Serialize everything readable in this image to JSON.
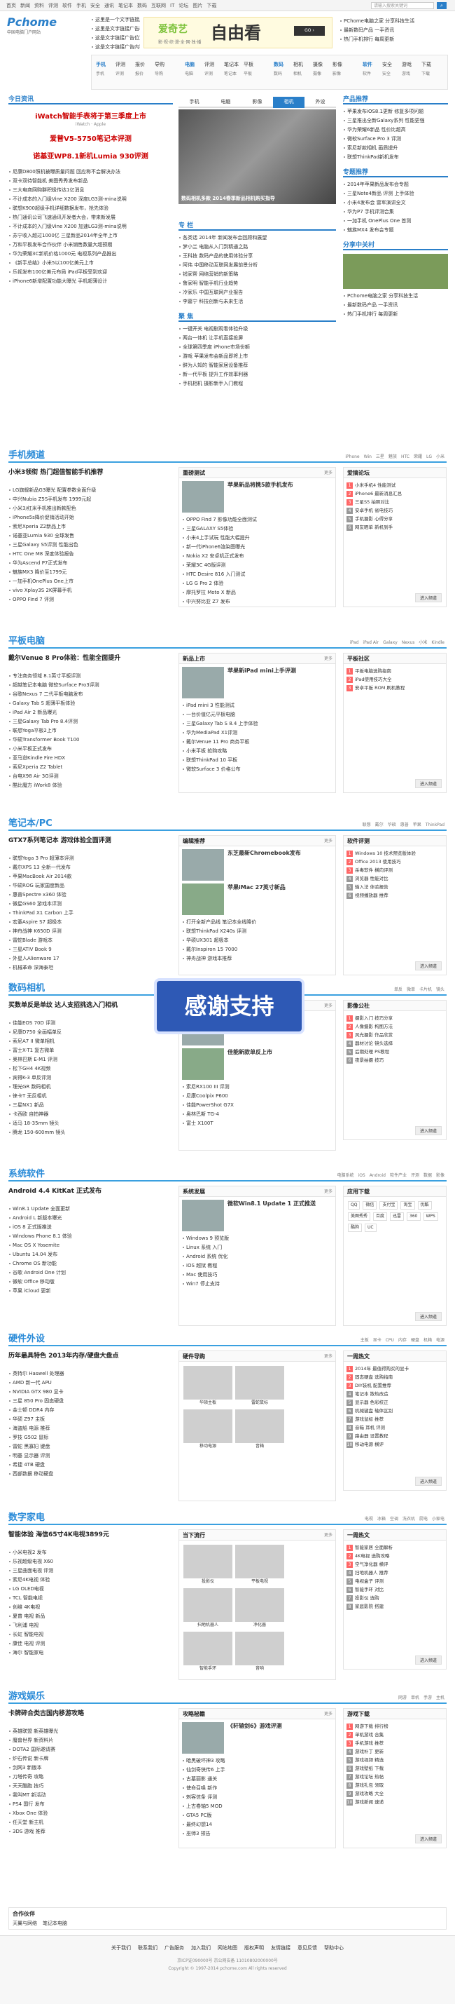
{
  "topbar": {
    "links": [
      "首页",
      "新闻",
      "资料",
      "评测",
      "软件",
      "手机",
      "安全",
      "通讯",
      "笔记本",
      "数码",
      "互联网",
      "IT",
      "论坛",
      "图片",
      "下载"
    ],
    "login": "请输入搜索关键词"
  },
  "logo": {
    "text": "Pchome",
    "sub": "中国电脑门户网站"
  },
  "top_left_links": [
    "这里是一个文字链接广告",
    "这里是文字链接广告标题",
    "这是文字链接广告位置",
    "这是文字链接广告内容"
  ],
  "banner": {
    "brand": "爱奇艺",
    "big": "自由看",
    "slogan": "影·视·综·漫·全·网·独·播"
  },
  "nav_groups": [
    [
      "手机",
      "评测",
      "报价",
      "导购"
    ],
    [
      "电脑",
      "评测",
      "笔记本",
      "平板"
    ],
    [
      "数码",
      "相机",
      "摄像",
      "影像"
    ],
    [
      "软件",
      "安全",
      "游戏",
      "下载"
    ]
  ],
  "today": {
    "title": "今日资讯",
    "headline1": "iWatch智能手表将于第三季度上市",
    "headline2": "爱普V5-5750笔记本评测",
    "headline3": "诺基亚WP8.1新机Lumia 930评测",
    "list": [
      "尼康D800照机被曝质量问题 回应称不会解决办法",
      "双卡双待智能机 美图秀秀发布新品",
      "三大电商网购群积极传达1亿消息",
      "不计成本的入门级Vine X200 深度LG3测-mina说明",
      "联想K900超级手机详细数据发布，抢先体验",
      "热门通讯公司飞速通讯开发者大会，带来新发展",
      "不计成本的入门级Vine X200 加速LG3测-mina说明",
      "苏宁收入超过1000亿 三星新品2014年全年上市",
      "万和平板发布合作伙伴 小米销售数量大超预期",
      "华为荣耀3C新机价格1000元 电视系列产品推出",
      "《新手总结》小米5以100亿美元上市",
      "乐视发布100亿美元布局 iPad平板受到欢迎",
      "iPhone6新增配置功能大曝光 手机超薄设计"
    ]
  },
  "slides": {
    "tabs": [
      "手机",
      "电脑",
      "影像",
      "相机",
      "外设"
    ],
    "caption": "数码相机多款 2014春季新品相机购买指导"
  },
  "topic": {
    "title": "专 栏",
    "items": [
      "各类话 2014年 新闻发布会回顾和展望",
      "梦小兰 电脑从入门到精通之路",
      "王科技 数码产品的使用体验分享",
      "阿伟 中国移动互联网发展前景分析",
      "钱家帮 网络营销的新策略",
      "鲁家明 智能手机行业趋势",
      "冷家乐 中国互联网产业报告",
      "李嘉宁 科技创新与未来生活"
    ]
  },
  "focus": {
    "title": "聚 焦",
    "items": [
      "一键开关 电视剧观看体验升级",
      "两台一体机 让手机直接投屏",
      "全球第四季度 iPhone市场份额",
      "游戏 苹果发布会新品即将上市",
      "鲜为人知的 智能家居设备推荐",
      "新一代平板 提升工作效率利器",
      "手机相机 摄影新手入门教程"
    ]
  },
  "right1": {
    "title": "产品推荐",
    "items": [
      "苹果发布iOS8.1更新 修复多项问题",
      "三星推出全新Galaxy系列 性能更强",
      "华为荣耀6新品 性价比超高",
      "微软Surface Pro 3 评测",
      "索尼新款相机 画质提升",
      "联想ThinkPad新机发布"
    ]
  },
  "right2": {
    "title": "专题推荐",
    "items": [
      "2014年苹果新品发布会专题",
      "三星Note4新品 评测 上手体验",
      "小米4发布会 雷军演讲全文",
      "华为P7 手机评测合集",
      "一加手机 OnePlus One 首测",
      "魅族MX4 发布会专题"
    ]
  },
  "right3": {
    "title": "分享中关村",
    "items": [
      "PChome电脑之家 分享科技生活",
      "最新数码产品 一手资讯",
      "热门手机排行 每周更新"
    ]
  },
  "sec_phone": {
    "title": "手机频道",
    "nav": [
      "iPhone",
      "Win",
      "三星",
      "魅族",
      "HTC",
      "荣耀",
      "LG",
      "小米"
    ],
    "head": "小米3领衔 热门超值智能手机推荐",
    "list": [
      "LG旗舰新品G3曝光 配置参数全面升级",
      "中兴Nubia Z5S手机发布 1999元起",
      "小米3/红米手机推出新款配色",
      "iPhone5s降价促销活动开始",
      "索尼Xperia Z2新品上市",
      "诺基亚Lumia 930 全球发售",
      "三星Galaxy S5评测 性能出色",
      "HTC One M8 深度体验报告",
      "华为Ascend P7正式发布",
      "魅族MX3 降价至1799元",
      "一加手机OnePlus One上市",
      "vivo Xplay3S 2K屏幕手机",
      "OPPO Find 7 评测"
    ],
    "mid_title": "重磅测试",
    "mid_head": "苹果新品将携5款手机发布",
    "mid_list": [
      "OPPO Find 7 影像功能全面测试",
      "三星GALAXY S5体验",
      "小米4上手试玩 性能大幅提升",
      "新一代iPhone6渲染图曝光",
      "Nokia X2 安卓机正式发布",
      "荣耀3C 4G版评测",
      "HTC Desire 816 入门测试",
      "LG G Pro 2 体验",
      "摩托罗拉 Moto X 新品",
      "中兴努比亚 Z7 发布"
    ],
    "right_title": "爱搞论坛",
    "right_list": [
      "小米手机4 性能测试",
      "iPhone6 最新消息汇总",
      "三星S5 拍照对比",
      "安卓手机 省电技巧",
      "手机摄影 心得分享",
      "网友晒单 新机到手"
    ]
  },
  "sec_tablet": {
    "title": "平板电脑",
    "nav": [
      "iPad",
      "iPad Air",
      "Galaxy",
      "Nexus",
      "小米",
      "Kindle"
    ],
    "head": "戴尔Venue 8 Pro体验：性能全面提升",
    "list": [
      "专注商务领域 8.1英寸平板评测",
      "超越笔记本电脑 微软Surface Pro3评测",
      "谷歌Nexus 7 二代平板电脑发布",
      "Galaxy Tab S 超薄平板体验",
      "iPad Air 2 新品曝光",
      "三星Galaxy Tab Pro 8.4评测",
      "联想Yoga平板2上市",
      "华硕Transformer Book T100",
      "小米平板正式发布",
      "亚马逊Kindle Fire HDX",
      "索尼Xperia Z2 Tablet",
      "台电X98 Air 3G评测",
      "酷比魔方 iWork8 体验"
    ],
    "mid_title": "新品上市",
    "mid_head": "苹果新iPad mini上手评测",
    "mid_list": [
      "iPad mini 3 性能测试",
      "一台价值亿元平板电脑",
      "三星Galaxy Tab S 8.4 上手体验",
      "华为MediaPad X1评测",
      "戴尔Venue 11 Pro 商务平板",
      "小米平板 抢购攻略",
      "联想ThinkPad 10 平板",
      "微软Surface 3 价格公布"
    ],
    "right_title": "平板社区",
    "right_list": [
      "平板电脑选购指南",
      "iPad使用技巧大全",
      "安卓平板 ROM 刷机教程"
    ]
  },
  "sec_note": {
    "title": "笔记本/PC",
    "nav": [
      "联想",
      "戴尔",
      "华硕",
      "惠普",
      "苹果",
      "ThinkPad"
    ],
    "head": "GTX7系列笔记本 游戏体验全面评测",
    "list": [
      "联想Yoga 3 Pro 超薄本评测",
      "戴尔XPS 13 全新一代发布",
      "苹果MacBook Air 2014款",
      "华硕ROG 玩家国度新品",
      "惠普Spectre x360 体验",
      "微星GS60 游戏本评测",
      "ThinkPad X1 Carbon 上手",
      "宏碁Aspire S7 超极本",
      "神舟战神 K650D 评测",
      "雷蛇Blade 游戏本",
      "三星ATIV Book 9",
      "外星人Alienware 17",
      "机械革命 深海泰坦"
    ],
    "mid_title": "编辑推荐",
    "mid_head1": "东芝最新Chromebook发布",
    "mid_head2": "苹果iMac 27英寸新品",
    "mid_list": [
      "打开全新产品线 笔记本全线降价",
      "联想ThinkPad X240s 评测",
      "华硕UX301 超极本",
      "戴尔Inspiron 15 7000",
      "神舟战神 游戏本推荐"
    ],
    "right_title": "软件评测",
    "right_list": [
      "Windows 10 技术预览版体验",
      "Office 2013 使用技巧",
      "杀毒软件 横向评测",
      "浏览器 性能对比",
      "输入法 体验报告",
      "视频播放器 推荐"
    ]
  },
  "sec_camera": {
    "title": "数码相机",
    "nav": [
      "单反",
      "微单",
      "卡片机",
      "镜头"
    ],
    "head": "买数单反是单纹 达人支招挑选入门相机",
    "list": [
      "佳能EOS 70D 评测",
      "尼康D750 全画幅单反",
      "索尼A7 II 微单相机",
      "富士X-T1 复古微单",
      "奥林巴斯 E-M1 评测",
      "松下GH4 4K视频",
      "宾得K-3 单反评测",
      "理光GR 数码相机",
      "徕卡T 无反相机",
      "三星NX1 新品",
      "卡西欧 自拍神器",
      "适马 18-35mm 镜头",
      "腾龙 150-600mm 镜头"
    ],
    "mid_title": "数码相机",
    "mid_head1": "卡西欧新品 女神自拍神器",
    "mid_head2": "佳能新款单反上市",
    "mid_list": [
      "索尼RX100 III 评测",
      "尼康Coolpix P600",
      "佳能PowerShot G7X",
      "奥林巴斯 TG-4",
      "富士 X100T"
    ],
    "right_title": "影像公社",
    "right_list": [
      "摄影入门 技巧分享",
      "人像摄影 构图方法",
      "风光摄影 作品欣赏",
      "器材讨论 镜头选择",
      "后期处理 PS教程",
      "夜景拍摄 技巧"
    ]
  },
  "thanks": "感谢支持",
  "sec_soft": {
    "title": "系统软件",
    "nav": [
      "电脑系统",
      "iOS",
      "Android",
      "软件产业",
      "评测",
      "数据",
      "影像"
    ],
    "head": "Android 4.4 KitKat 正式发布",
    "list": [
      "Win8.1 Update 全面更新",
      "Android L 新版本曝光",
      "iOS 8 正式版推送",
      "Windows Phone 8.1 体验",
      "Mac OS X Yosemite",
      "Ubuntu 14.04 发布",
      "Chrome OS 新功能",
      "谷歌 Android One 计划",
      "微软 Office 移动版",
      "苹果 iCloud 更新"
    ],
    "mid_title": "系统发展",
    "mid_head": "微软Win8.1 Update 1 正式推送",
    "mid_list": [
      "Windows 9 预览版",
      "Linux 系统 入门",
      "Android 系统 优化",
      "iOS 越狱 教程",
      "Mac 使用技巧",
      "Win7 停止支持"
    ],
    "right_title": "应用下载",
    "apps": [
      "QQ",
      "微信",
      "支付宝",
      "淘宝",
      "优酷",
      "美图秀秀",
      "百度",
      "迅雷",
      "360",
      "WPS",
      "酷狗",
      "UC"
    ]
  },
  "sec_hard": {
    "title": "硬件外设",
    "nav": [
      "主板",
      "显卡",
      "CPU",
      "内存",
      "硬盘",
      "机箱",
      "电源"
    ],
    "head": "历年最具特色 2013年内存/硬盘大盘点",
    "list": [
      "英特尔 Haswell 处理器",
      "AMD 新一代 APU",
      "NVIDIA GTX 980 显卡",
      "三星 850 Pro 固态硬盘",
      "金士顿 DDR4 内存",
      "华硕 Z97 主板",
      "海盗船 电源 推荐",
      "罗技 G502 鼠标",
      "雷蛇 黑寡妇 键盘",
      "明基 显示器 评测",
      "希捷 4TB 硬盘",
      "西部数据 移动硬盘"
    ],
    "mid_title": "硬件导购",
    "mid_items": [
      "华硕主板",
      "雷蛇鼠标",
      "移动电源",
      "音箱"
    ],
    "right_title": "一周热文",
    "right_list": [
      "2014年 最值得购买的显卡",
      "固态硬盘 选购指南",
      "DIY装机 配置推荐",
      "笔记本 散热改造",
      "显示器 色彩校正",
      "机械键盘 轴体区别",
      "游戏鼠标 推荐",
      "音箱 耳机 评测",
      "路由器 设置教程",
      "移动电源 横评"
    ]
  },
  "sec_home": {
    "title": "数字家电",
    "nav": [
      "电视",
      "冰箱",
      "空调",
      "洗衣机",
      "厨电",
      "小家电"
    ],
    "head": "智能体验 海信65寸4K电视3899元",
    "list": [
      "小米电视2 发布",
      "乐视超级电视 X60",
      "三星曲面电视 评测",
      "索尼4K电视 体验",
      "LG OLED电视",
      "TCL 智能电视",
      "创维 4K电视",
      "夏普 电视 新品",
      "飞利浦 电视",
      "长虹 智能电视",
      "康佳 电视 评测",
      "海尔 智能家电"
    ],
    "mid_title": "当下流行",
    "mid_items": [
      "投影仪",
      "平板电视",
      "扫地机器人",
      "净化器",
      "智能手环",
      "音响"
    ],
    "right_title": "一周热文",
    "right_list": [
      "智能家居 全面解析",
      "4K电视 选购攻略",
      "空气净化器 横评",
      "扫地机器人 推荐",
      "电视盒子 评测",
      "智能手环 对比",
      "投影仪 选购",
      "家庭影院 搭建"
    ]
  },
  "sec_game": {
    "title": "游戏娱乐",
    "nav": [
      "网游",
      "单机",
      "手游",
      "主机"
    ],
    "head": "卡牌碎合类古国内移游攻略",
    "list": [
      "英雄联盟 新英雄曝光",
      "魔兽世界 新资料片",
      "DOTA2 国际邀请赛",
      "炉石传说 新卡牌",
      "剑网3 新版本",
      "刀塔传奇 攻略",
      "天天酷跑 技巧",
      "我叫MT 新活动",
      "PS4 国行 发布",
      "Xbox One 体验",
      "任天堂 新主机",
      "3DS 游戏 推荐"
    ],
    "mid_title": "攻略秘籍",
    "mid_head": "《轩辕剑6》游戏评测",
    "mid_list": [
      "暗黑破坏神3 攻略",
      "仙剑奇侠传6 上手",
      "古墓丽影 通关",
      "使命召唤 新作",
      "刺客信条 评测",
      "上古卷轴5 MOD",
      "GTA5 PC版",
      "最终幻想14",
      "巫师3 预告"
    ],
    "right_title": "游戏下载",
    "right_list": [
      "网游下载 排行榜",
      "单机游戏 合集",
      "手机游戏 推荐",
      "游戏补丁 更新",
      "游戏视频 精选",
      "游戏壁纸 下载",
      "游戏论坛 热帖",
      "游戏礼包 领取",
      "游戏攻略 大全",
      "游戏新闻 速递"
    ]
  },
  "partners": {
    "title": "合作伙伴",
    "links": [
      "天翼与网络",
      "笔记本电脑"
    ]
  },
  "footer": {
    "links": [
      "关于我们",
      "联系我们",
      "广告服务",
      "加入我们",
      "网站地图",
      "版权声明",
      "友情链接",
      "意见反馈",
      "帮助中心"
    ],
    "copy": "Copyright © 1997-2014 pchome.com All rights reserved",
    "icp": "京ICP证090000号 京公网安备 11010802000000号"
  },
  "more_label": "更多",
  "enter_label": "进入频道"
}
